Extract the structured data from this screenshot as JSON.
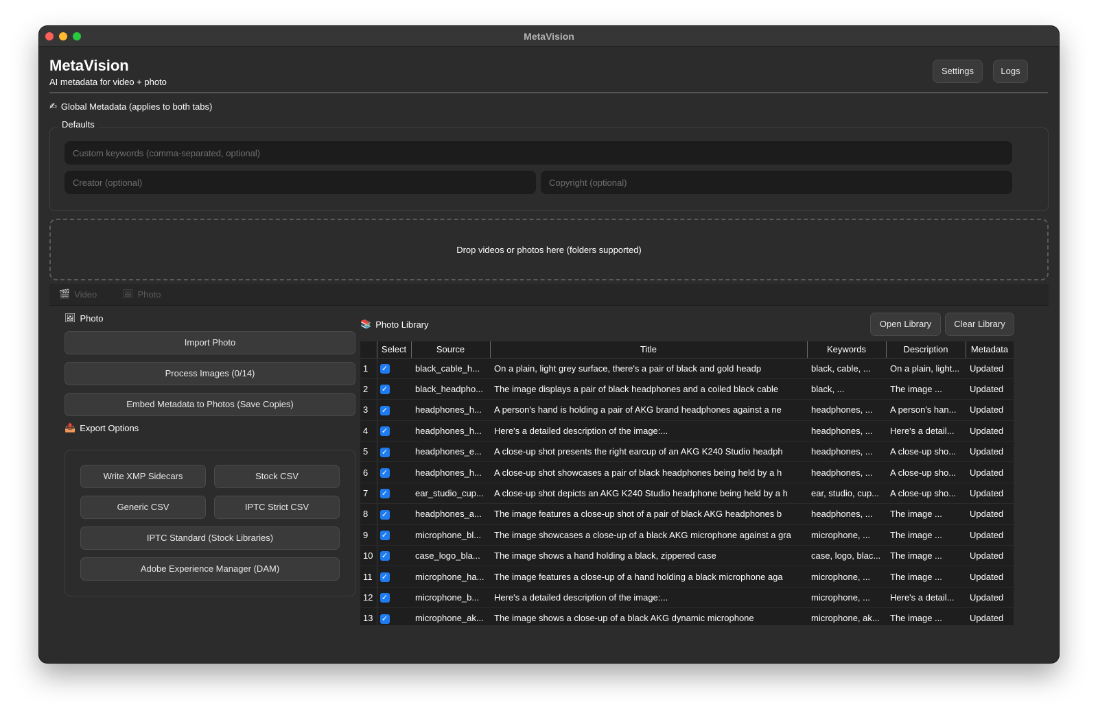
{
  "window": {
    "title": "MetaVision"
  },
  "header": {
    "app_title": "MetaVision",
    "subtitle": "AI metadata for video + photo",
    "settings_label": "Settings",
    "logs_label": "Logs"
  },
  "global": {
    "label": "Global Metadata (applies to both tabs)",
    "icon": "✍",
    "defaults_label": "Defaults",
    "keywords_placeholder": "Custom keywords (comma-separated, optional)",
    "creator_placeholder": "Creator (optional)",
    "copyright_placeholder": "Copyright (optional)"
  },
  "dropzone": {
    "text": "Drop videos or photos here (folders supported)"
  },
  "tabs": [
    {
      "label": "Video",
      "icon": "🎬"
    },
    {
      "label": "Photo",
      "icon": "🖼"
    }
  ],
  "photo_panel": {
    "label": "Photo",
    "icon": "🖼",
    "import_label": "Import Photo",
    "process_label": "Process Images (0/14)",
    "embed_label": "Embed Metadata to Photos (Save Copies)",
    "export_label": "Export Options",
    "export_icon": "📤",
    "export_buttons": {
      "xmp": "Write XMP Sidecars",
      "stock_csv": "Stock CSV",
      "generic_csv": "Generic CSV",
      "iptc_strict": "IPTC Strict CSV",
      "iptc_standard": "IPTC Standard (Stock Libraries)",
      "adobe_dam": "Adobe Experience Manager (DAM)"
    }
  },
  "library": {
    "label": "Photo Library",
    "icon": "📚",
    "open_label": "Open Library",
    "clear_label": "Clear Library",
    "columns": [
      "Select",
      "Source",
      "Title",
      "Keywords",
      "Description",
      "Metadata"
    ],
    "rows": [
      {
        "n": "1",
        "source": "black_cable_h...",
        "title": "On a plain, light grey surface, there's a pair of black and gold headp",
        "keywords": "black, cable, ...",
        "description": "On a plain, light...",
        "metadata": "Updated"
      },
      {
        "n": "2",
        "source": "black_headpho...",
        "title": "The image displays a pair of black headphones and a coiled black cable",
        "keywords": "black, ...",
        "description": "The image ...",
        "metadata": "Updated"
      },
      {
        "n": "3",
        "source": "headphones_h...",
        "title": "A person's hand is holding a pair of AKG brand headphones against a ne",
        "keywords": "headphones, ...",
        "description": "A person's han...",
        "metadata": "Updated"
      },
      {
        "n": "4",
        "source": "headphones_h...",
        "title": "Here's a detailed description of the image:...",
        "keywords": "headphones, ...",
        "description": "Here's a detail...",
        "metadata": "Updated"
      },
      {
        "n": "5",
        "source": "headphones_e...",
        "title": "A close-up shot presents the right earcup of an AKG K240 Studio headph",
        "keywords": "headphones, ...",
        "description": "A close-up sho...",
        "metadata": "Updated"
      },
      {
        "n": "6",
        "source": "headphones_h...",
        "title": "A close-up shot showcases a pair of black headphones being held by a h",
        "keywords": "headphones, ...",
        "description": "A close-up sho...",
        "metadata": "Updated"
      },
      {
        "n": "7",
        "source": "ear_studio_cup...",
        "title": "A close-up shot depicts an AKG K240 Studio headphone being held by a h",
        "keywords": "ear, studio, cup...",
        "description": "A close-up sho...",
        "metadata": "Updated"
      },
      {
        "n": "8",
        "source": "headphones_a...",
        "title": "The image features a close-up shot of a pair of black AKG headphones b",
        "keywords": "headphones, ...",
        "description": "The image ...",
        "metadata": "Updated"
      },
      {
        "n": "9",
        "source": "microphone_bl...",
        "title": "The image showcases a close-up of a black AKG microphone against a gra",
        "keywords": "microphone, ...",
        "description": "The image ...",
        "metadata": "Updated"
      },
      {
        "n": "10",
        "source": "case_logo_bla...",
        "title": "The image shows a hand holding a black, zippered case",
        "keywords": "case, logo, blac...",
        "description": "The image ...",
        "metadata": "Updated"
      },
      {
        "n": "11",
        "source": "microphone_ha...",
        "title": "The image features a close-up of a hand holding a black microphone aga",
        "keywords": "microphone, ...",
        "description": "The image ...",
        "metadata": "Updated"
      },
      {
        "n": "12",
        "source": "microphone_b...",
        "title": "Here's a detailed description of the image:...",
        "keywords": "microphone, ...",
        "description": "Here's a detail...",
        "metadata": "Updated"
      },
      {
        "n": "13",
        "source": "microphone_ak...",
        "title": "The image shows a close-up of a black AKG dynamic microphone",
        "keywords": "microphone, ak...",
        "description": "The image ...",
        "metadata": "Updated"
      }
    ]
  }
}
